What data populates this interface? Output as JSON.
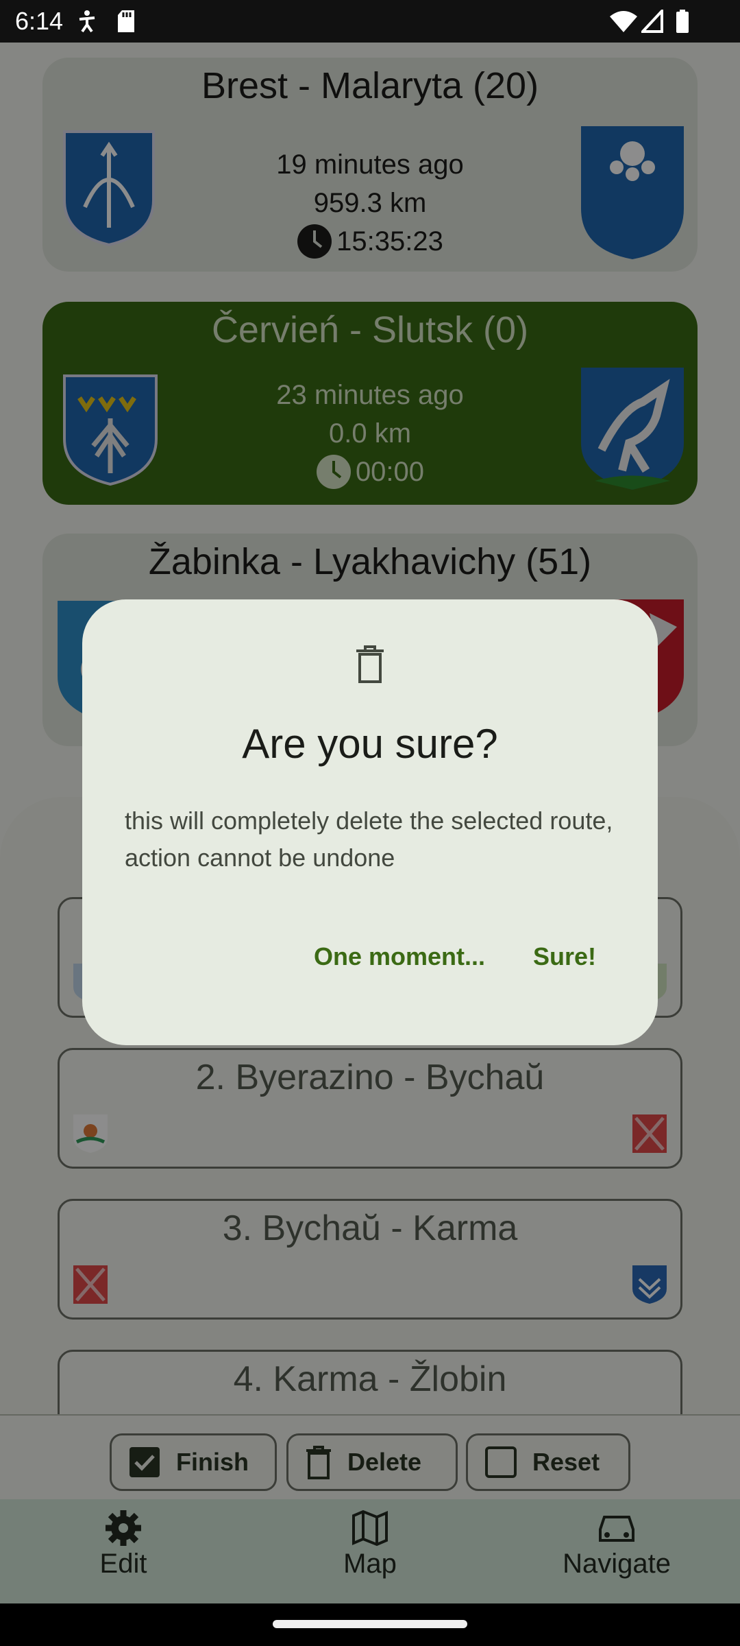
{
  "status_bar": {
    "time": "6:14"
  },
  "routes": [
    {
      "title": "Brest - Malaryta (20)",
      "ago": "19 minutes ago",
      "distance": "959.3 km",
      "duration": "15:35:23"
    },
    {
      "title": "Červień - Slutsk (0)",
      "ago": "23 minutes ago",
      "distance": "0.0 km",
      "duration": "00:00"
    },
    {
      "title": "Žabinka - Lyakhavichy (51)"
    }
  ],
  "legs": [
    {
      "label": ""
    },
    {
      "label": "2. Byerazino - Bychaŭ"
    },
    {
      "label": "3. Bychaŭ - Karma"
    },
    {
      "label": "4. Karma - Žlobin"
    }
  ],
  "actions": {
    "finish": "Finish",
    "delete": "Delete",
    "reset": "Reset"
  },
  "nav": {
    "edit": "Edit",
    "map": "Map",
    "navigate": "Navigate"
  },
  "dialog": {
    "title": "Are you sure?",
    "body": "this will completely delete the selected route, action cannot be undone",
    "cancel": "One moment...",
    "confirm": "Sure!"
  },
  "colors": {
    "accent": "#3b6a14",
    "active_card": "#3a6b14",
    "dialog_bg": "#e6ebe1"
  }
}
